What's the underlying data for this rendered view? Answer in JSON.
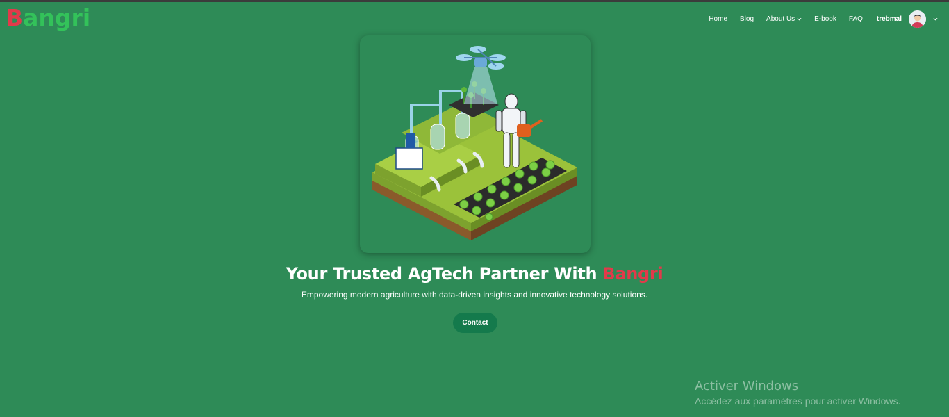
{
  "brand": {
    "logo_first": "B",
    "logo_rest": "angri",
    "logo_b_color": "#e23a4a",
    "logo_color": "#33c25a"
  },
  "nav": {
    "items": [
      {
        "label": "Home"
      },
      {
        "label": "Blog"
      },
      {
        "label": "About Us",
        "icon": "chevron-down-icon"
      },
      {
        "label": "E-book"
      },
      {
        "label": "FAQ"
      }
    ],
    "username": "trebmal",
    "avatar_icon": "avatar",
    "menu_icon": "chevron-down-icon"
  },
  "hero": {
    "image_icon": "smart-farm-illustration",
    "headline_prefix": "Your Trusted AgTech Partner With ",
    "headline_brand": "Bangri",
    "subtitle": "Empowering modern agriculture with data-driven insights and innovative technology solutions.",
    "cta_label": "Contact"
  },
  "watermark": {
    "title": "Activer Windows",
    "subtitle": "Accédez aux paramètres pour activer Windows."
  },
  "colors": {
    "background": "#2e8b57",
    "accent_red": "#e23a4a",
    "button": "#147a4c"
  }
}
